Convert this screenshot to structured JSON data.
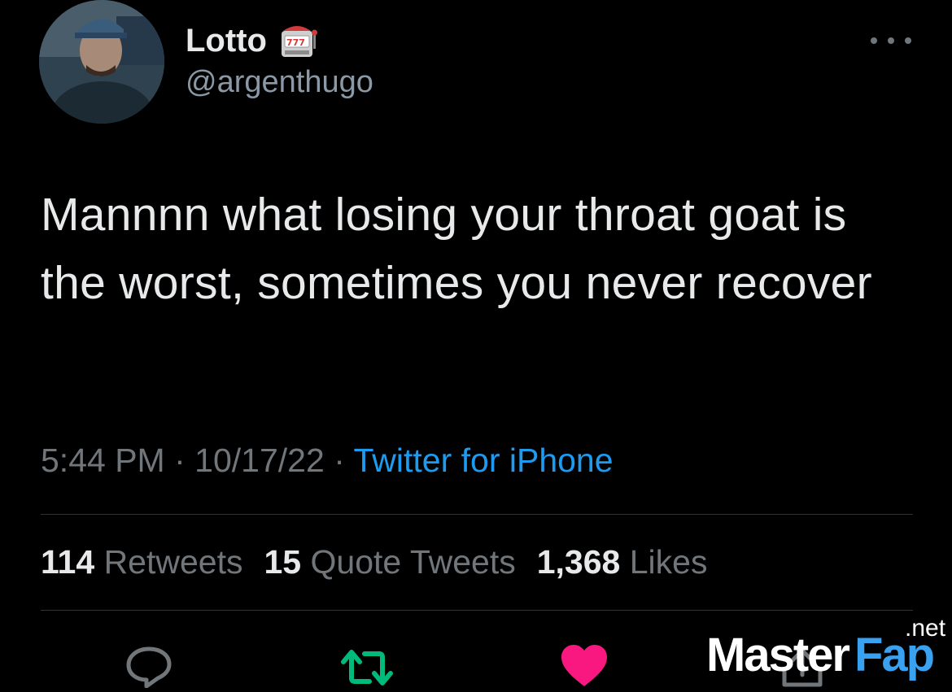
{
  "user": {
    "display_name": "Lotto",
    "handle": "@argenthugo",
    "name_emoji": "slot-machine-icon"
  },
  "tweet": {
    "text": "Mannnn what losing your throat goat is the worst, sometimes you never recover",
    "time": "5:44 PM",
    "separator": "·",
    "date": "10/17/22",
    "source": "Twitter for iPhone"
  },
  "stats": {
    "retweets_count": "114",
    "retweets_label": "Retweets",
    "quotes_count": "15",
    "quotes_label": "Quote Tweets",
    "likes_count": "1,368",
    "likes_label": "Likes"
  },
  "actions": [
    "reply-icon",
    "retweet-icon",
    "like-icon",
    "share-icon"
  ],
  "colors": {
    "background": "#000000",
    "text": "#e7e9ea",
    "secondary": "#71767b",
    "link": "#1d9bf0",
    "retweet": "#00ba7c",
    "like": "#f91880"
  },
  "watermark": {
    "part1": "Master",
    "part2": "Fap",
    "tld": ".net"
  }
}
